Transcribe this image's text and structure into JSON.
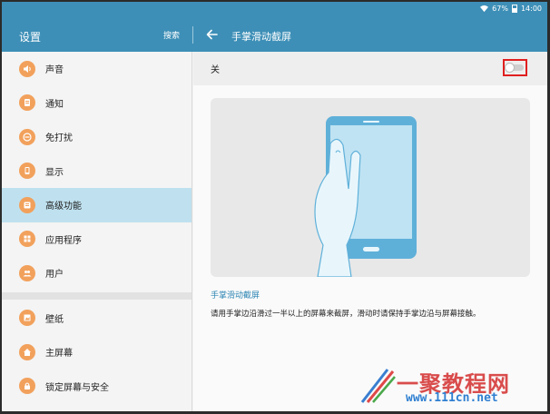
{
  "status": {
    "battery": "67%",
    "time": "14:00"
  },
  "header": {
    "settings_title": "设置",
    "search_label": "搜索",
    "page_title": "手掌滑动截屏"
  },
  "sidebar": {
    "items": [
      {
        "label": "声音",
        "icon": "sound-icon"
      },
      {
        "label": "通知",
        "icon": "notification-icon"
      },
      {
        "label": "免打扰",
        "icon": "do-not-disturb-icon"
      },
      {
        "label": "显示",
        "icon": "display-icon"
      },
      {
        "label": "高级功能",
        "icon": "advanced-features-icon",
        "active": true
      },
      {
        "label": "应用程序",
        "icon": "apps-icon"
      },
      {
        "label": "用户",
        "icon": "users-icon"
      },
      {
        "label": "壁纸",
        "icon": "wallpaper-icon"
      },
      {
        "label": "主屏幕",
        "icon": "home-screen-icon"
      },
      {
        "label": "锁定屏幕与安全",
        "icon": "lock-icon"
      }
    ]
  },
  "main": {
    "toggle_label": "关",
    "toggle_state": "off",
    "caption_title": "手掌滑动截屏",
    "description": "请用手掌边沿滑过一半以上的屏幕来截屏，滑动时请保持手掌边沿与屏幕接触。"
  },
  "watermark": {
    "text": "一聚教程网",
    "url": "www.111cn.net"
  },
  "colors": {
    "accent": "#3d8fb7",
    "icon_orange": "#f2a15c",
    "active_bg": "#bfe1ef",
    "highlight": "#e02020"
  }
}
